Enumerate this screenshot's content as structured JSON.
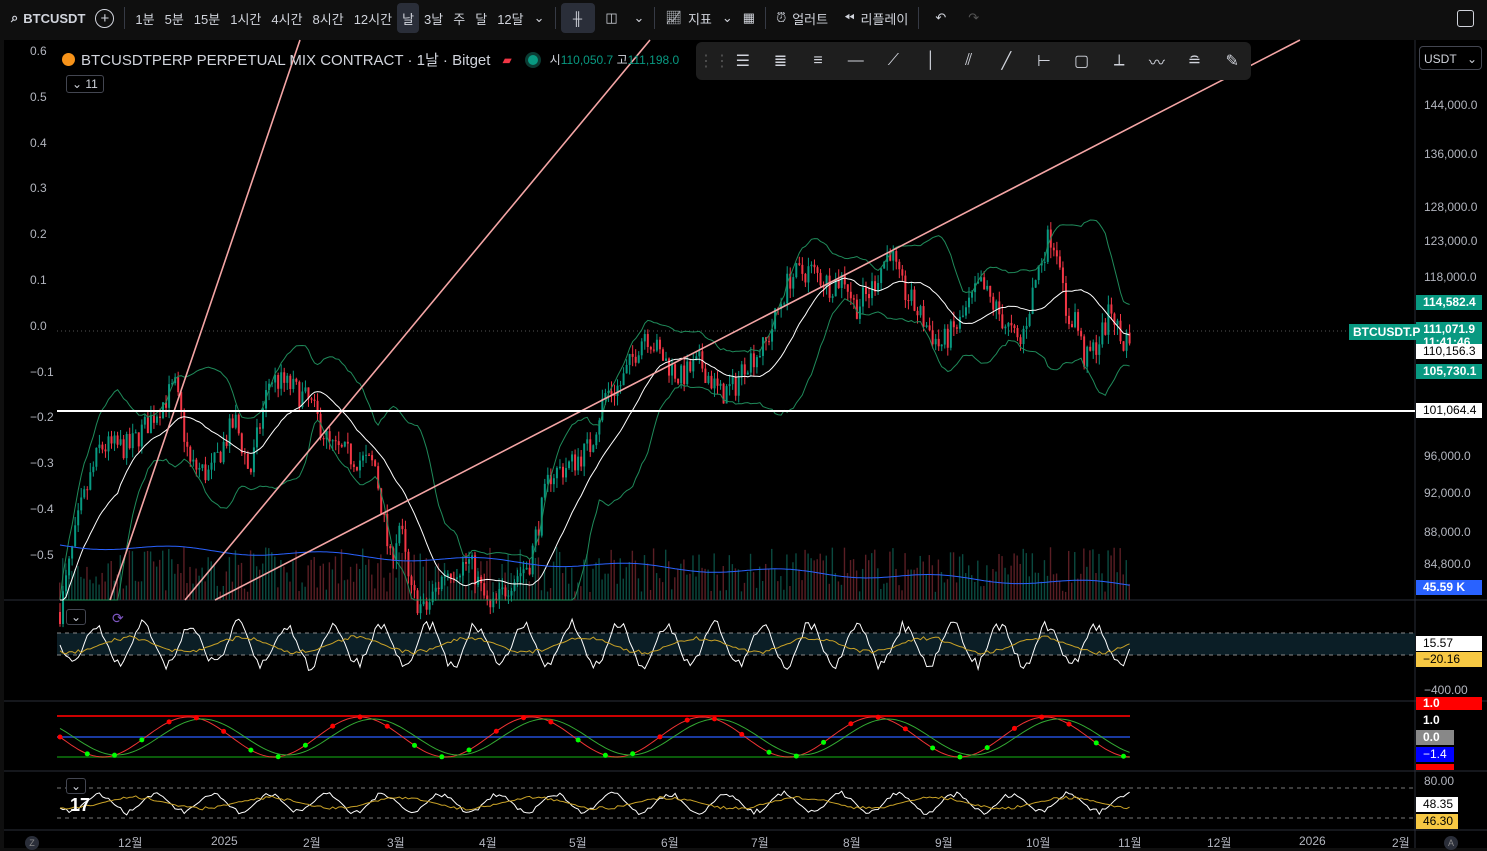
{
  "topbar": {
    "symbol": "BTCUSDT",
    "intervals": [
      "1분",
      "5분",
      "15분",
      "1시간",
      "4시간",
      "8시간",
      "12시간",
      "날",
      "3날",
      "주",
      "달",
      "12달"
    ],
    "active_interval": "날",
    "indicators": "지표",
    "alerts": "얼러트",
    "replay": "리플레이"
  },
  "legend": {
    "title": "BTCUSDTPERP PERPETUAL MIX CONTRACT · 1날 · Bitget",
    "open_label": "시",
    "open": "110,050.7",
    "high_label": "고",
    "high": "111,198.0",
    "collapsed_count": "11"
  },
  "currency": "USDT",
  "left_axis": [
    "0.6",
    "0.5",
    "0.4",
    "0.3",
    "0.2",
    "0.1",
    "0.0",
    "−0.1",
    "−0.2",
    "−0.3",
    "−0.4",
    "−0.5"
  ],
  "price_axis": [
    {
      "label": "144,000.0",
      "price": 144000
    },
    {
      "label": "136,000.0",
      "price": 136000
    },
    {
      "label": "128,000.0",
      "price": 128000
    },
    {
      "label": "123,000.0",
      "price": 123000
    },
    {
      "label": "118,000.0",
      "price": 118000
    },
    {
      "label": "96,000.0",
      "price": 96000
    },
    {
      "label": "92,000.0",
      "price": 92000
    },
    {
      "label": "88,000.0",
      "price": 88000
    },
    {
      "label": "84,800.0",
      "price": 84800
    }
  ],
  "price_tags": [
    {
      "label": "114,582.4",
      "bg": "#089981",
      "fg": "#ffffff",
      "price": 114582
    },
    {
      "label": "111,071.9",
      "bg": "#089981",
      "fg": "#ffffff",
      "price": 111072
    },
    {
      "label": "11:41:46",
      "bg": "#089981",
      "fg": "#ffffff",
      "price": 109500
    },
    {
      "label": "110,156.3",
      "bg": "#ffffff",
      "fg": "#000000",
      "price": 108300
    },
    {
      "label": "105,730.1",
      "bg": "#089981",
      "fg": "#ffffff",
      "price": 105730
    },
    {
      "label": "101,064.4",
      "bg": "#ffffff",
      "fg": "#000000",
      "price": 101064
    }
  ],
  "symbol_tag": "BTCUSDT.P",
  "volume_tag": "45.59 K",
  "pane2": {
    "tags": [
      "15.57",
      "−20.16"
    ],
    "min": "−400.00"
  },
  "pane3": {
    "tags": [
      "1.0",
      "1.0",
      "0.0",
      "−1.4"
    ]
  },
  "pane4": {
    "max": "80.00",
    "tags": [
      "48.35",
      "46.30"
    ]
  },
  "time_axis": [
    "12월",
    "2025",
    "2월",
    "3월",
    "4월",
    "5월",
    "6월",
    "7월",
    "8월",
    "9월",
    "10월",
    "11월",
    "12월",
    "2026",
    "2월"
  ],
  "support_level": 101064.4,
  "price_path": [
    [
      60,
      80000
    ],
    [
      80,
      90000
    ],
    [
      100,
      97000
    ],
    [
      130,
      97000
    ],
    [
      150,
      100000
    ],
    [
      175,
      104000
    ],
    [
      190,
      95000
    ],
    [
      210,
      94000
    ],
    [
      235,
      100000
    ],
    [
      250,
      94000
    ],
    [
      270,
      105000
    ],
    [
      290,
      104000
    ],
    [
      310,
      102000
    ],
    [
      330,
      97000
    ],
    [
      350,
      96000
    ],
    [
      375,
      95000
    ],
    [
      390,
      85000
    ],
    [
      400,
      89000
    ],
    [
      410,
      82000
    ],
    [
      425,
      80000
    ],
    [
      445,
      84000
    ],
    [
      470,
      85000
    ],
    [
      490,
      80000
    ],
    [
      510,
      83000
    ],
    [
      530,
      85000
    ],
    [
      550,
      94000
    ],
    [
      570,
      95000
    ],
    [
      590,
      97000
    ],
    [
      605,
      103000
    ],
    [
      620,
      104000
    ],
    [
      645,
      111000
    ],
    [
      660,
      108000
    ],
    [
      680,
      105000
    ],
    [
      700,
      107000
    ],
    [
      720,
      103000
    ],
    [
      735,
      104000
    ],
    [
      745,
      107000
    ],
    [
      765,
      109000
    ],
    [
      790,
      118000
    ],
    [
      810,
      119000
    ],
    [
      830,
      117000
    ],
    [
      845,
      118000
    ],
    [
      855,
      114000
    ],
    [
      870,
      116000
    ],
    [
      890,
      122000
    ],
    [
      900,
      117000
    ],
    [
      915,
      114000
    ],
    [
      940,
      109000
    ],
    [
      960,
      112000
    ],
    [
      980,
      117000
    ],
    [
      1000,
      113000
    ],
    [
      1020,
      109000
    ],
    [
      1040,
      120000
    ],
    [
      1050,
      124000
    ],
    [
      1060,
      121000
    ],
    [
      1065,
      112000
    ],
    [
      1075,
      113000
    ],
    [
      1085,
      107000
    ],
    [
      1100,
      110000
    ],
    [
      1112,
      114000
    ],
    [
      1122,
      109000
    ],
    [
      1130,
      111000
    ]
  ]
}
